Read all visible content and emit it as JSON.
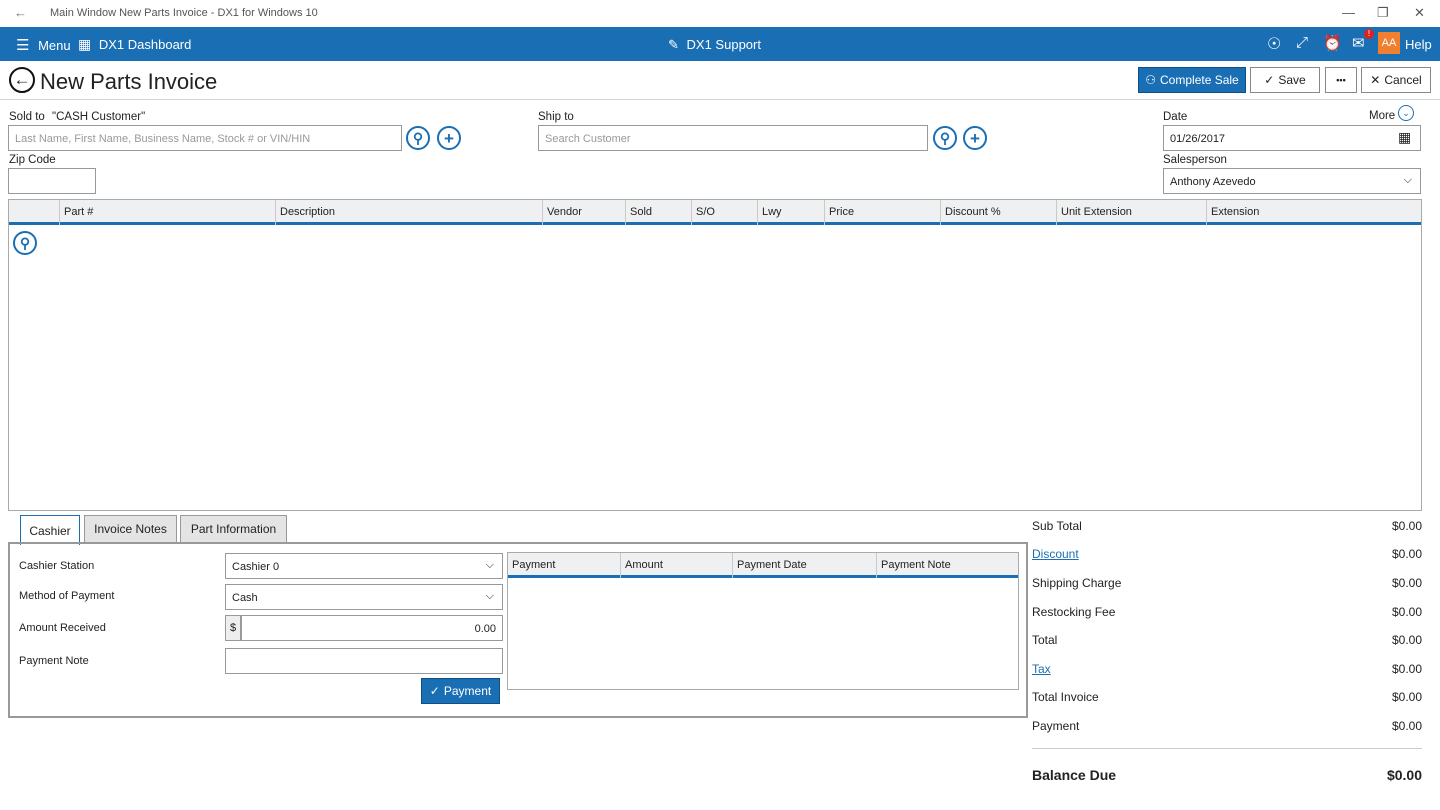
{
  "window": {
    "title": "Main Window New Parts Invoice - DX1 for Windows 10"
  },
  "topbar": {
    "menu_label": "Menu",
    "dashboard_label": "DX1 Dashboard",
    "support_label": "DX1 Support",
    "avatar_initials": "AA",
    "help_label": "Help",
    "notification_badge": "!"
  },
  "header": {
    "title": "New Parts Invoice",
    "complete_sale_label": "Complete Sale",
    "save_label": "Save",
    "more_dots": "•••",
    "cancel_label": "Cancel"
  },
  "form": {
    "sold_to_label": "Sold to",
    "sold_to_customer": "\"CASH Customer\"",
    "sold_to_placeholder": "Last Name, First Name, Business Name, Stock # or VIN/HIN",
    "zip_label": "Zip Code",
    "zip_value": "",
    "ship_to_label": "Ship to",
    "ship_to_placeholder": "Search Customer",
    "date_label": "Date",
    "date_value": "01/26/2017",
    "more_label": "More",
    "salesperson_label": "Salesperson",
    "salesperson_value": "Anthony Azevedo"
  },
  "grid": {
    "columns": [
      "Part #",
      "Description",
      "Vendor",
      "Sold",
      "S/O",
      "Lwy",
      "Price",
      "Discount %",
      "Unit Extension",
      "Extension"
    ]
  },
  "tabs": [
    "Cashier",
    "Invoice Notes",
    "Part Information"
  ],
  "cashier": {
    "station_label": "Cashier Station",
    "station_value": "Cashier 0",
    "method_label": "Method of Payment",
    "method_value": "Cash",
    "amount_label": "Amount Received",
    "currency": "$",
    "amount_value": "0.00",
    "note_label": "Payment Note",
    "note_value": "",
    "payment_button": "Payment",
    "payments_columns": [
      "Payment",
      "Amount",
      "Payment Date",
      "Payment Note"
    ]
  },
  "summary": {
    "rows": [
      {
        "label": "Sub Total",
        "value": "$0.00"
      },
      {
        "label": "Discount",
        "value": "$0.00"
      },
      {
        "label": "Shipping Charge",
        "value": "$0.00"
      },
      {
        "label": "Restocking Fee",
        "value": "$0.00"
      },
      {
        "label": "Total",
        "value": "$0.00"
      },
      {
        "label": "Tax",
        "value": "$0.00"
      },
      {
        "label": "Total Invoice",
        "value": "$0.00"
      },
      {
        "label": "Payment",
        "value": "$0.00"
      }
    ],
    "balance_label": "Balance Due",
    "balance_value": "$0.00"
  },
  "colors": {
    "accent": "#1a6fb4",
    "avatar": "#f08030",
    "badge": "#e02020"
  }
}
